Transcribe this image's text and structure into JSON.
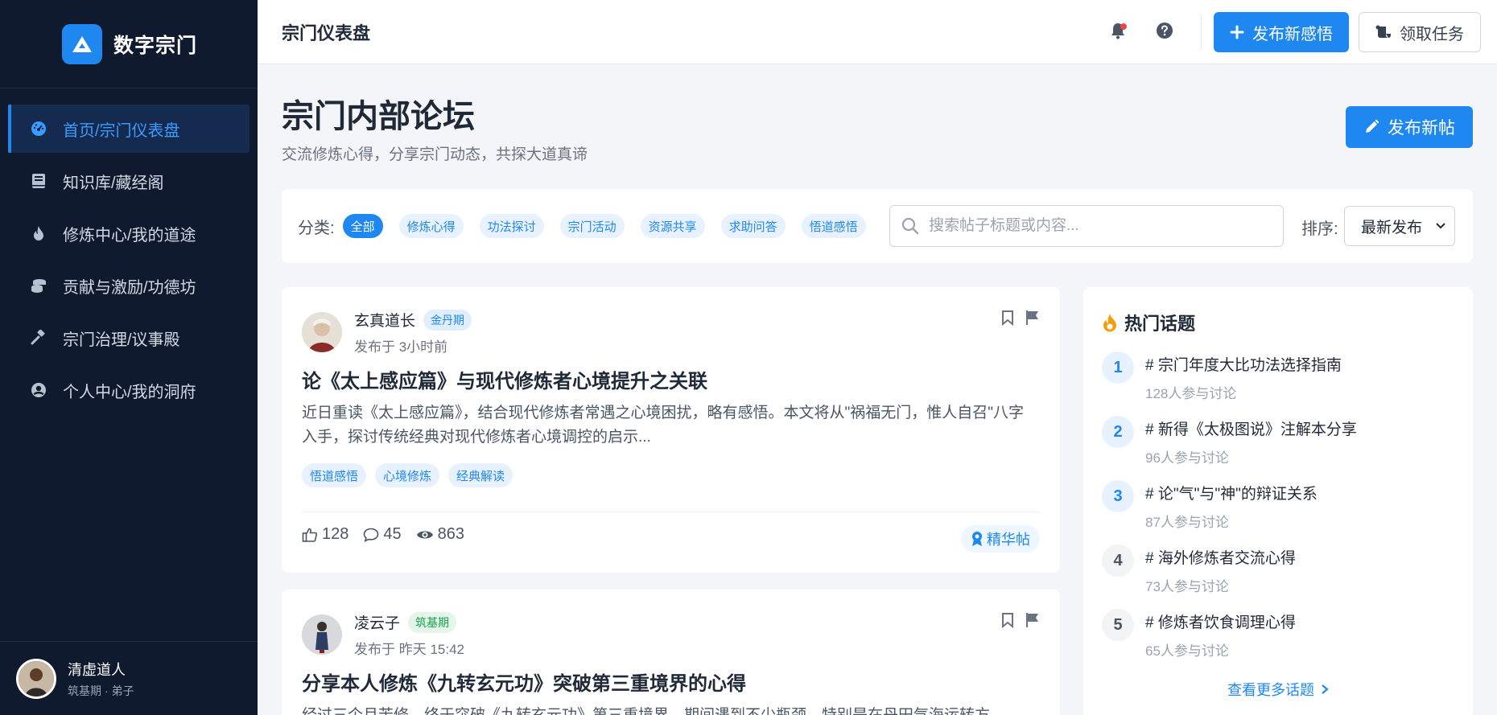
{
  "colors": {
    "accent": "#1e88f0",
    "sidebar_bg": "#0f1a2e",
    "active_nav_bg": "#142a4f",
    "notification": "#ef4444",
    "hot_icon": "#f59e0b"
  },
  "brand": {
    "name": "数字宗门",
    "icon": "mountain-logo-icon"
  },
  "sidebar": {
    "items": [
      {
        "label": "首页/宗门仪表盘",
        "icon": "dashboard-gauge-icon",
        "active": true
      },
      {
        "label": "知识库/藏经阁",
        "icon": "book-icon",
        "active": false
      },
      {
        "label": "修炼中心/我的道途",
        "icon": "flame-icon",
        "active": false
      },
      {
        "label": "贡献与激励/功德坊",
        "icon": "coins-icon",
        "active": false
      },
      {
        "label": "宗门治理/议事殿",
        "icon": "gavel-icon",
        "active": false
      },
      {
        "label": "个人中心/我的洞府",
        "icon": "user-circle-icon",
        "active": false
      }
    ],
    "profile": {
      "name": "清虚道人",
      "subtitle": "筑基期 · 弟子"
    }
  },
  "topbar": {
    "title": "宗门仪表盘",
    "publish_label": "发布新感悟",
    "task_label": "领取任务"
  },
  "page": {
    "title": "宗门内部论坛",
    "subtitle": "交流修炼心得，分享宗门动态，共探大道真谛",
    "new_post_label": "发布新帖"
  },
  "filters": {
    "category_label": "分类:",
    "categories": [
      "全部",
      "修炼心得",
      "功法探讨",
      "宗门活动",
      "资源共享",
      "求助问答",
      "悟道感悟"
    ],
    "active_category": "全部",
    "search_placeholder": "搜索帖子标题或内容...",
    "sort_label": "排序:",
    "sort_value": "最新发布"
  },
  "posts": [
    {
      "author": "玄真道长",
      "rank": "金丹期",
      "time": "发布于 3小时前",
      "title": "论《太上感应篇》与现代修炼者心境提升之关联",
      "excerpt": "近日重读《太上感应篇》，结合现代修炼者常遇之心境困扰，略有感悟。本文将从\"祸福无门，惟人自召\"八字入手，探讨传统经典对现代修炼者心境调控的启示...",
      "tags": [
        "悟道感悟",
        "心境修炼",
        "经典解读"
      ],
      "likes": "128",
      "comments": "45",
      "views": "863",
      "badge": "精华帖"
    },
    {
      "author": "凌云子",
      "rank": "筑基期",
      "time": "发布于 昨天 15:42",
      "title": "分享本人修炼《九转玄元功》突破第三重境界的心得",
      "excerpt": "经过三个月苦修，终于突破《九转玄元功》第三重境界，期间遇到不少瓶颈，特别是在丹田气海运转方"
    }
  ],
  "hot_topics": {
    "title": "热门话题",
    "items": [
      {
        "rank": "1",
        "name": "# 宗门年度大比功法选择指南",
        "count": "128人参与讨论"
      },
      {
        "rank": "2",
        "name": "# 新得《太极图说》注解本分享",
        "count": "96人参与讨论"
      },
      {
        "rank": "3",
        "name": "# 论\"气\"与\"神\"的辩证关系",
        "count": "87人参与讨论"
      },
      {
        "rank": "4",
        "name": "# 海外修炼者交流心得",
        "count": "73人参与讨论"
      },
      {
        "rank": "5",
        "name": "# 修炼者饮食调理心得",
        "count": "65人参与讨论"
      }
    ],
    "more_label": "查看更多话题"
  }
}
